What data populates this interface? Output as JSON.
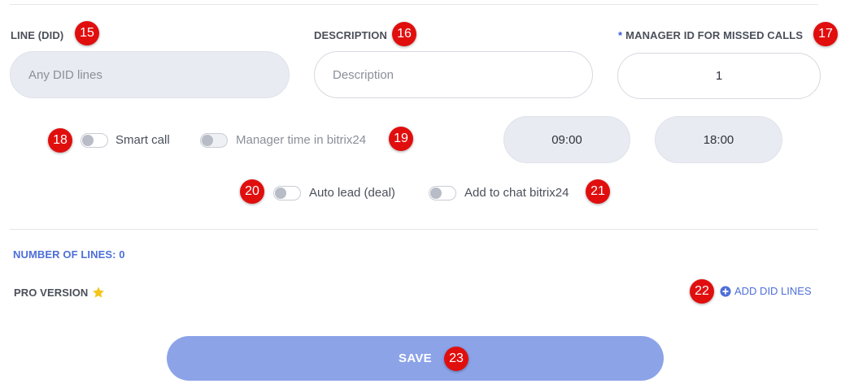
{
  "fields": {
    "line": {
      "label": "LINE (DID)",
      "placeholder": "Any DID lines"
    },
    "description": {
      "label": "DESCRIPTION",
      "placeholder": "Description"
    },
    "manager": {
      "required_mark": "*",
      "label": "MANAGER ID FOR MISSED CALLS",
      "value": "1"
    }
  },
  "toggles": {
    "smart_call": {
      "label": "Smart call",
      "on": false
    },
    "manager_time": {
      "label": "Manager time in bitrix24",
      "on": false
    },
    "auto_lead": {
      "label": "Auto lead (deal)",
      "on": false
    },
    "add_to_chat": {
      "label": "Add to chat bitrix24",
      "on": false
    }
  },
  "times": {
    "start": "09:00",
    "end": "18:00"
  },
  "number_of_lines": "NUMBER OF LINES: 0",
  "pro_version": {
    "label": "PRO VERSION",
    "icon": "star-icon"
  },
  "add_did_lines": {
    "label": "ADD DID LINES",
    "icon": "plus-circle-icon"
  },
  "save_label": "SAVE",
  "markers": [
    "15",
    "16",
    "17",
    "18",
    "19",
    "20",
    "21",
    "22",
    "23"
  ],
  "colors": {
    "accent": "#4e6fd9",
    "save_button": "#8ca3e8",
    "marker": "#e10e0e",
    "star": "#f5c518"
  }
}
